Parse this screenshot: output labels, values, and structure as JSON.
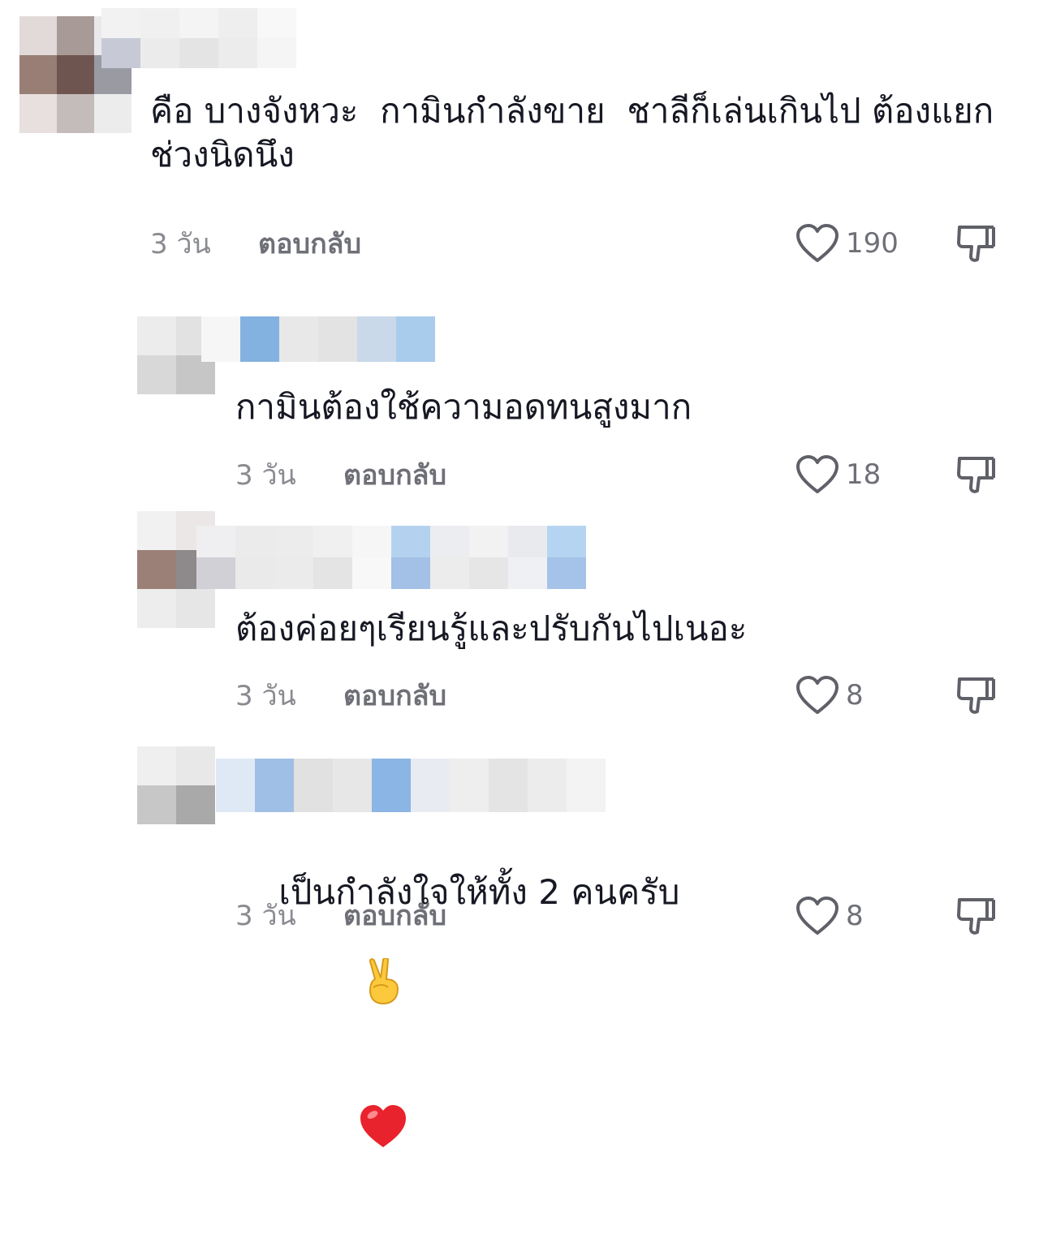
{
  "comments": [
    {
      "text": "คือ บางจังหวะ  กามินกำลังขาย  ชาลีก็เล่นเกินไป ต้องแยก ช่วงนิดนึง",
      "date": "3 วัน",
      "reply_label": "ตอบกลับ",
      "likes": "190",
      "icons": {
        "like": "heart-outline-icon",
        "dislike": "thumbs-down-icon"
      }
    },
    {
      "text": "กามินต้องใช้ความอดทนสูงมาก",
      "date": "3 วัน",
      "reply_label": "ตอบกลับ",
      "likes": "18",
      "icons": {
        "like": "heart-outline-icon",
        "dislike": "thumbs-down-icon"
      }
    },
    {
      "text": "ต้องค่อยๆเรียนรู้และปรับกันไปเนอะ",
      "date": "3 วัน",
      "reply_label": "ตอบกลับ",
      "likes": "8",
      "icons": {
        "like": "heart-outline-icon",
        "dislike": "thumbs-down-icon"
      }
    },
    {
      "text": "เป็นกำลังใจให้ทั้ง 2 คนครับ",
      "emojis": [
        "✌️",
        "❤️"
      ],
      "date": "3 วัน",
      "reply_label": "ตอบกลับ",
      "likes": "8",
      "icons": {
        "like": "heart-outline-icon",
        "dislike": "thumbs-down-icon"
      }
    }
  ],
  "colors": {
    "text": "#161823",
    "meta": "#8a8b91",
    "reply": "#6f7077",
    "icon": "#5f6068"
  }
}
